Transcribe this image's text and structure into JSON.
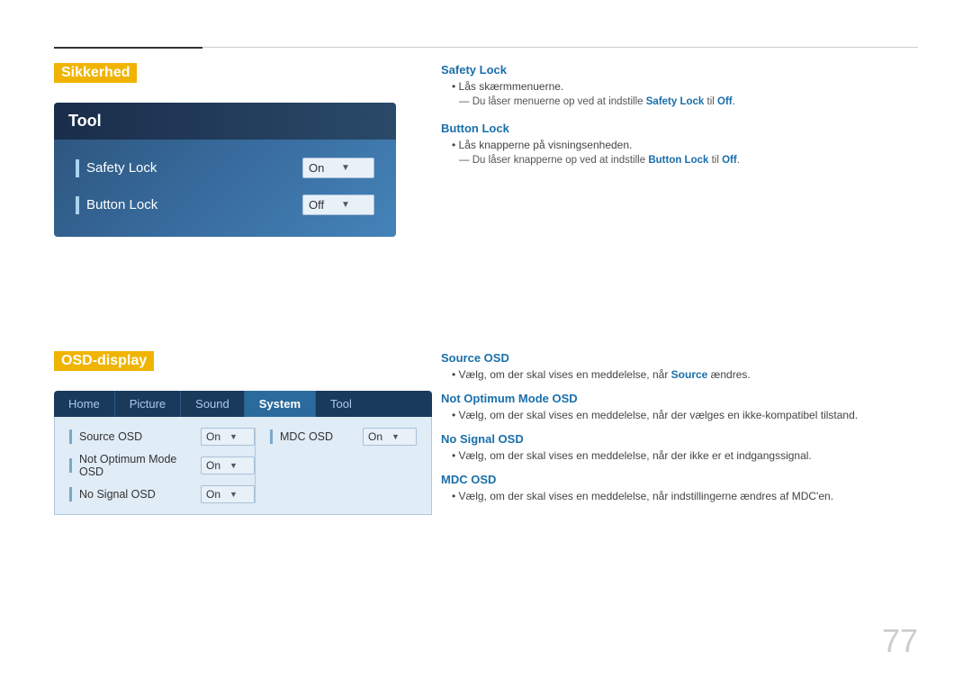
{
  "page": {
    "number": "77"
  },
  "top_line": {},
  "sikkerhed": {
    "heading": "Sikkerhed",
    "tool_panel": {
      "title": "Tool",
      "rows": [
        {
          "label": "Safety Lock",
          "value": "On"
        },
        {
          "label": "Button Lock",
          "value": "Off"
        }
      ]
    },
    "safety_lock_info": {
      "title": "Safety Lock",
      "bullet": "Lås skærmmenuerne.",
      "sub": "― Du låser menuerne op ved at indstille Safety Lock til Off."
    },
    "button_lock_info": {
      "title": "Button Lock",
      "bullet": "Lås knapperne på visningsenheden.",
      "sub": "― Du låser knapperne op ved at indstille Button Lock til Off."
    }
  },
  "osd_display": {
    "heading": "OSD-display",
    "nav_items": [
      {
        "label": "Home",
        "active": false
      },
      {
        "label": "Picture",
        "active": false
      },
      {
        "label": "Sound",
        "active": false
      },
      {
        "label": "System",
        "active": true
      },
      {
        "label": "Tool",
        "active": false
      }
    ],
    "rows_left": [
      {
        "label": "Source OSD",
        "value": "On"
      },
      {
        "label": "Not Optimum Mode OSD",
        "value": "On"
      },
      {
        "label": "No Signal OSD",
        "value": "On"
      }
    ],
    "rows_right": [
      {
        "label": "MDC OSD",
        "value": "On"
      }
    ],
    "source_osd_info": {
      "title": "Source OSD",
      "bullet": "Vælg, om der skal vises en meddelelse, når Source ændres."
    },
    "not_optimum_info": {
      "title": "Not Optimum Mode OSD",
      "bullet": "Vælg, om der skal vises en meddelelse, når der vælges en ikke-kompatibel tilstand."
    },
    "no_signal_info": {
      "title": "No Signal OSD",
      "bullet": "Vælg, om der skal vises en meddelelse, når der ikke er et indgangssignal."
    },
    "mdc_osd_info": {
      "title": "MDC OSD",
      "bullet": "Vælg, om der skal vises en meddelelse, når indstillingerne ændres af MDC'en."
    }
  }
}
